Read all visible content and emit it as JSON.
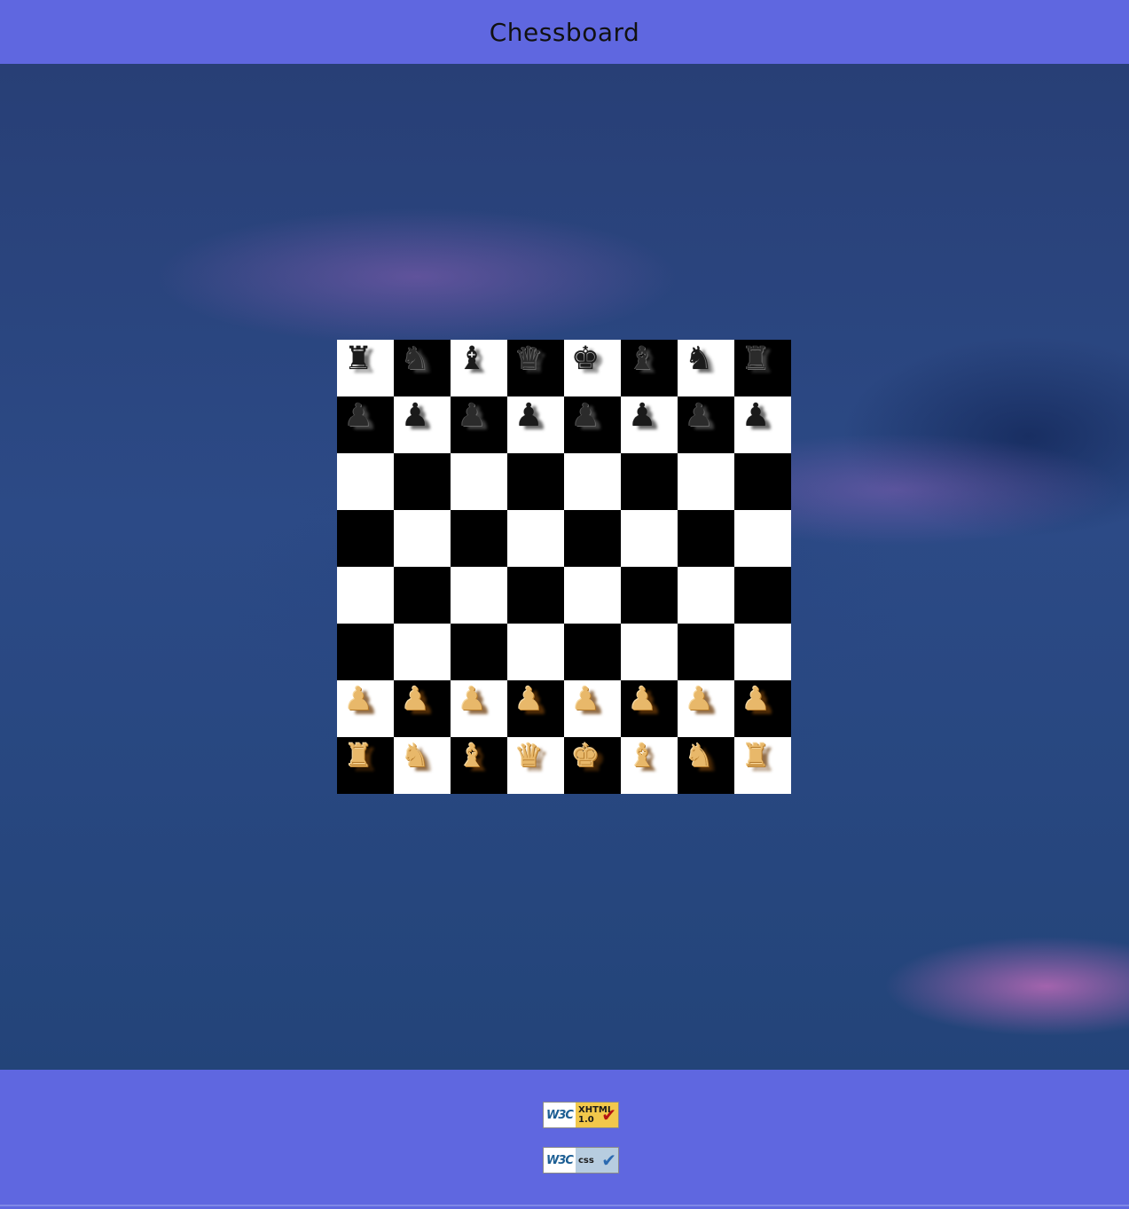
{
  "header": {
    "title": "Chessboard"
  },
  "colors": {
    "bar": "#5f67e0",
    "light_square": "#ffffff",
    "dark_square": "#000000",
    "white_piece": "#e8b86a",
    "black_piece": "#1a1a1a"
  },
  "board": {
    "rows": [
      [
        "black-rook",
        "black-knight",
        "black-bishop",
        "black-queen",
        "black-king",
        "black-bishop",
        "black-knight",
        "black-rook"
      ],
      [
        "black-pawn",
        "black-pawn",
        "black-pawn",
        "black-pawn",
        "black-pawn",
        "black-pawn",
        "black-pawn",
        "black-pawn"
      ],
      [
        "",
        "",
        "",
        "",
        "",
        "",
        "",
        ""
      ],
      [
        "",
        "",
        "",
        "",
        "",
        "",
        "",
        ""
      ],
      [
        "",
        "",
        "",
        "",
        "",
        "",
        "",
        ""
      ],
      [
        "",
        "",
        "",
        "",
        "",
        "",
        "",
        ""
      ],
      [
        "white-pawn",
        "white-pawn",
        "white-pawn",
        "white-pawn",
        "white-pawn",
        "white-pawn",
        "white-pawn",
        "white-pawn"
      ],
      [
        "white-rook",
        "white-knight",
        "white-bishop",
        "white-queen",
        "white-king",
        "white-bishop",
        "white-knight",
        "white-rook"
      ]
    ]
  },
  "footer": {
    "xhtml_badge": {
      "w3c": "W3C",
      "label_line1": "XHTML",
      "label_line2": "1.0",
      "icon": "check-icon"
    },
    "css_badge": {
      "w3c": "W3C",
      "label": "css",
      "icon": "check-icon"
    }
  }
}
